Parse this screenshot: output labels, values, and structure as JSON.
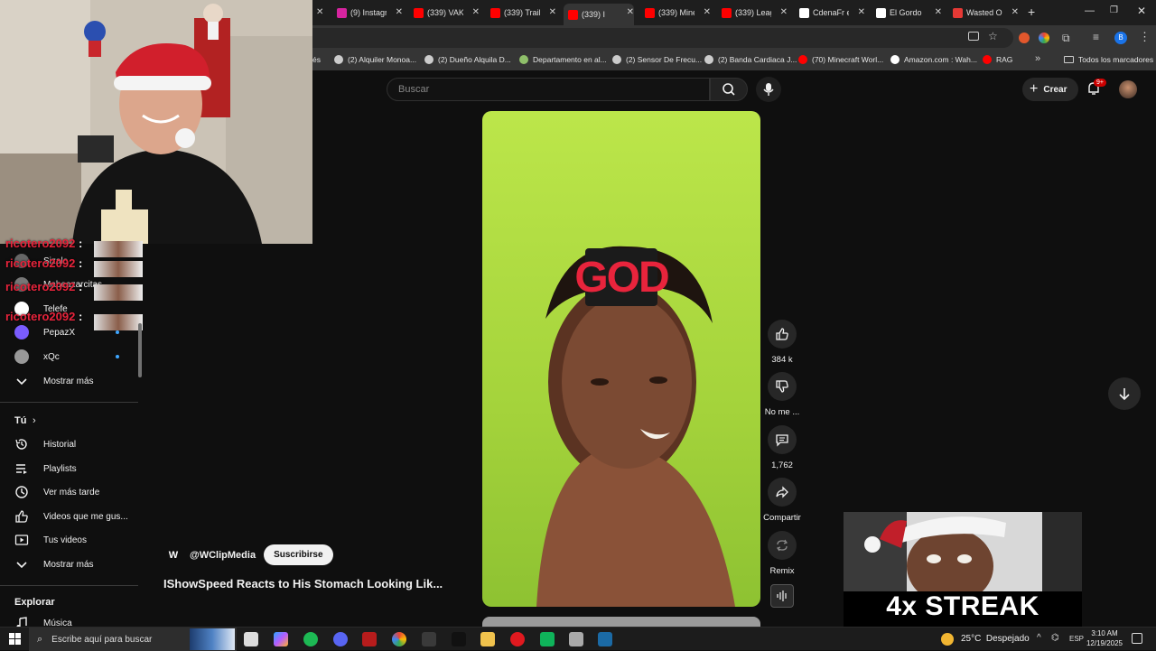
{
  "browser": {
    "tabs": [
      {
        "title": "(9) Instagram",
        "color": "#d6249f"
      },
      {
        "title": "(339) VAKI",
        "color": "#ff0000"
      },
      {
        "title": "(339) Trailer",
        "color": "#ff0000"
      },
      {
        "title": "(339) I",
        "color": "#ff0000",
        "active": true
      },
      {
        "title": "(339) Mine",
        "color": "#ff0000"
      },
      {
        "title": "(339) Leag",
        "color": "#ff0000"
      },
      {
        "title": "CdenaFr e",
        "color": "#ffffff"
      },
      {
        "title": "El Gordo",
        "color": "#ffffff"
      },
      {
        "title": "Wasted O",
        "color": "#e53935"
      }
    ],
    "bookmarks": [
      "(2) Alquiler Monoa...",
      "(2) Dueño Alquila D...",
      "Departamento en al...",
      "(2) Sensor De Frecu...",
      "(2) Banda Cardiaca J...",
      "(70) Minecraft Worl...",
      "Amazon.com : Wah...",
      "RAG"
    ],
    "all_bookmarks": "Todos los marcadores",
    "profile_letter": "B"
  },
  "overlay_chat": {
    "username": "ricotero2092",
    "separator": ":"
  },
  "sidebar": {
    "subscriptions": [
      {
        "label": "Sizalo",
        "icon": "channel-avatar-icon"
      },
      {
        "label": "Mabeazarcitas",
        "icon": "channel-avatar-icon"
      },
      {
        "label": "Telefe",
        "icon": "channel-avatar-icon"
      },
      {
        "label": "PepazX",
        "icon": "channel-avatar-icon"
      },
      {
        "label": "xQc",
        "icon": "channel-avatar-icon"
      }
    ],
    "show_more_1": "Mostrar más",
    "you_header": "Tú",
    "you_items": [
      {
        "label": "Historial",
        "icon": "history-icon"
      },
      {
        "label": "Playlists",
        "icon": "playlist-icon"
      },
      {
        "label": "Ver más tarde",
        "icon": "watch-later-icon"
      },
      {
        "label": "Videos que me gus...",
        "icon": "like-icon"
      },
      {
        "label": "Tus videos",
        "icon": "your-videos-icon"
      }
    ],
    "show_more_2": "Mostrar más",
    "explore_header": "Explorar",
    "explore_items": [
      {
        "label": "Música",
        "icon": "music-icon"
      }
    ]
  },
  "header": {
    "search_placeholder": "Buscar",
    "create_label": "Crear",
    "notifications_badge": "9+"
  },
  "short": {
    "channel_handle": "@WClipMedia",
    "subscribe_label": "Suscribirse",
    "title": "IShowSpeed Reacts to His Stomach Looking Lik...",
    "overlay_text": "GOD",
    "likes": "384 k",
    "dislike_label": "No me ...",
    "comments": "1,762",
    "share_label": "Compartir",
    "remix_label": "Remix"
  },
  "streak_overlay": {
    "text": "4x STREAK"
  },
  "taskbar": {
    "search_placeholder": "Escribe aquí para buscar",
    "weather": "25°C  Despejado",
    "language": "ESP",
    "time": "3:10 AM",
    "date": "12/19/2025"
  }
}
